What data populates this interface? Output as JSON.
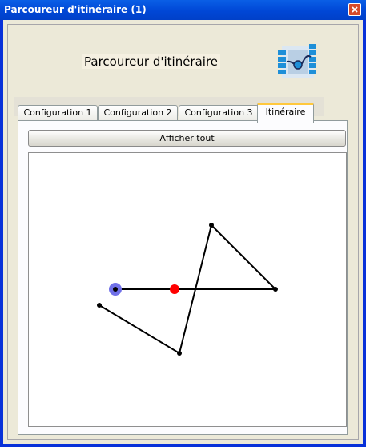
{
  "window": {
    "title": "Parcoureur d'itinéraire (1)"
  },
  "header": {
    "title": "Parcoureur d'itinéraire",
    "logo_icon": "route-map-icon"
  },
  "tabs": [
    {
      "label": "Configuration 1",
      "active": false
    },
    {
      "label": "Configuration 2",
      "active": false
    },
    {
      "label": "Configuration 3",
      "active": false
    },
    {
      "label": "Itinéraire",
      "active": true
    }
  ],
  "itinerary": {
    "show_all_label": "Afficher tout",
    "route_color": "#000000",
    "start_marker_color": "#7070e8",
    "current_marker_color": "#ff0000",
    "start_marker_index": 0,
    "current_marker_index": 1
  }
}
